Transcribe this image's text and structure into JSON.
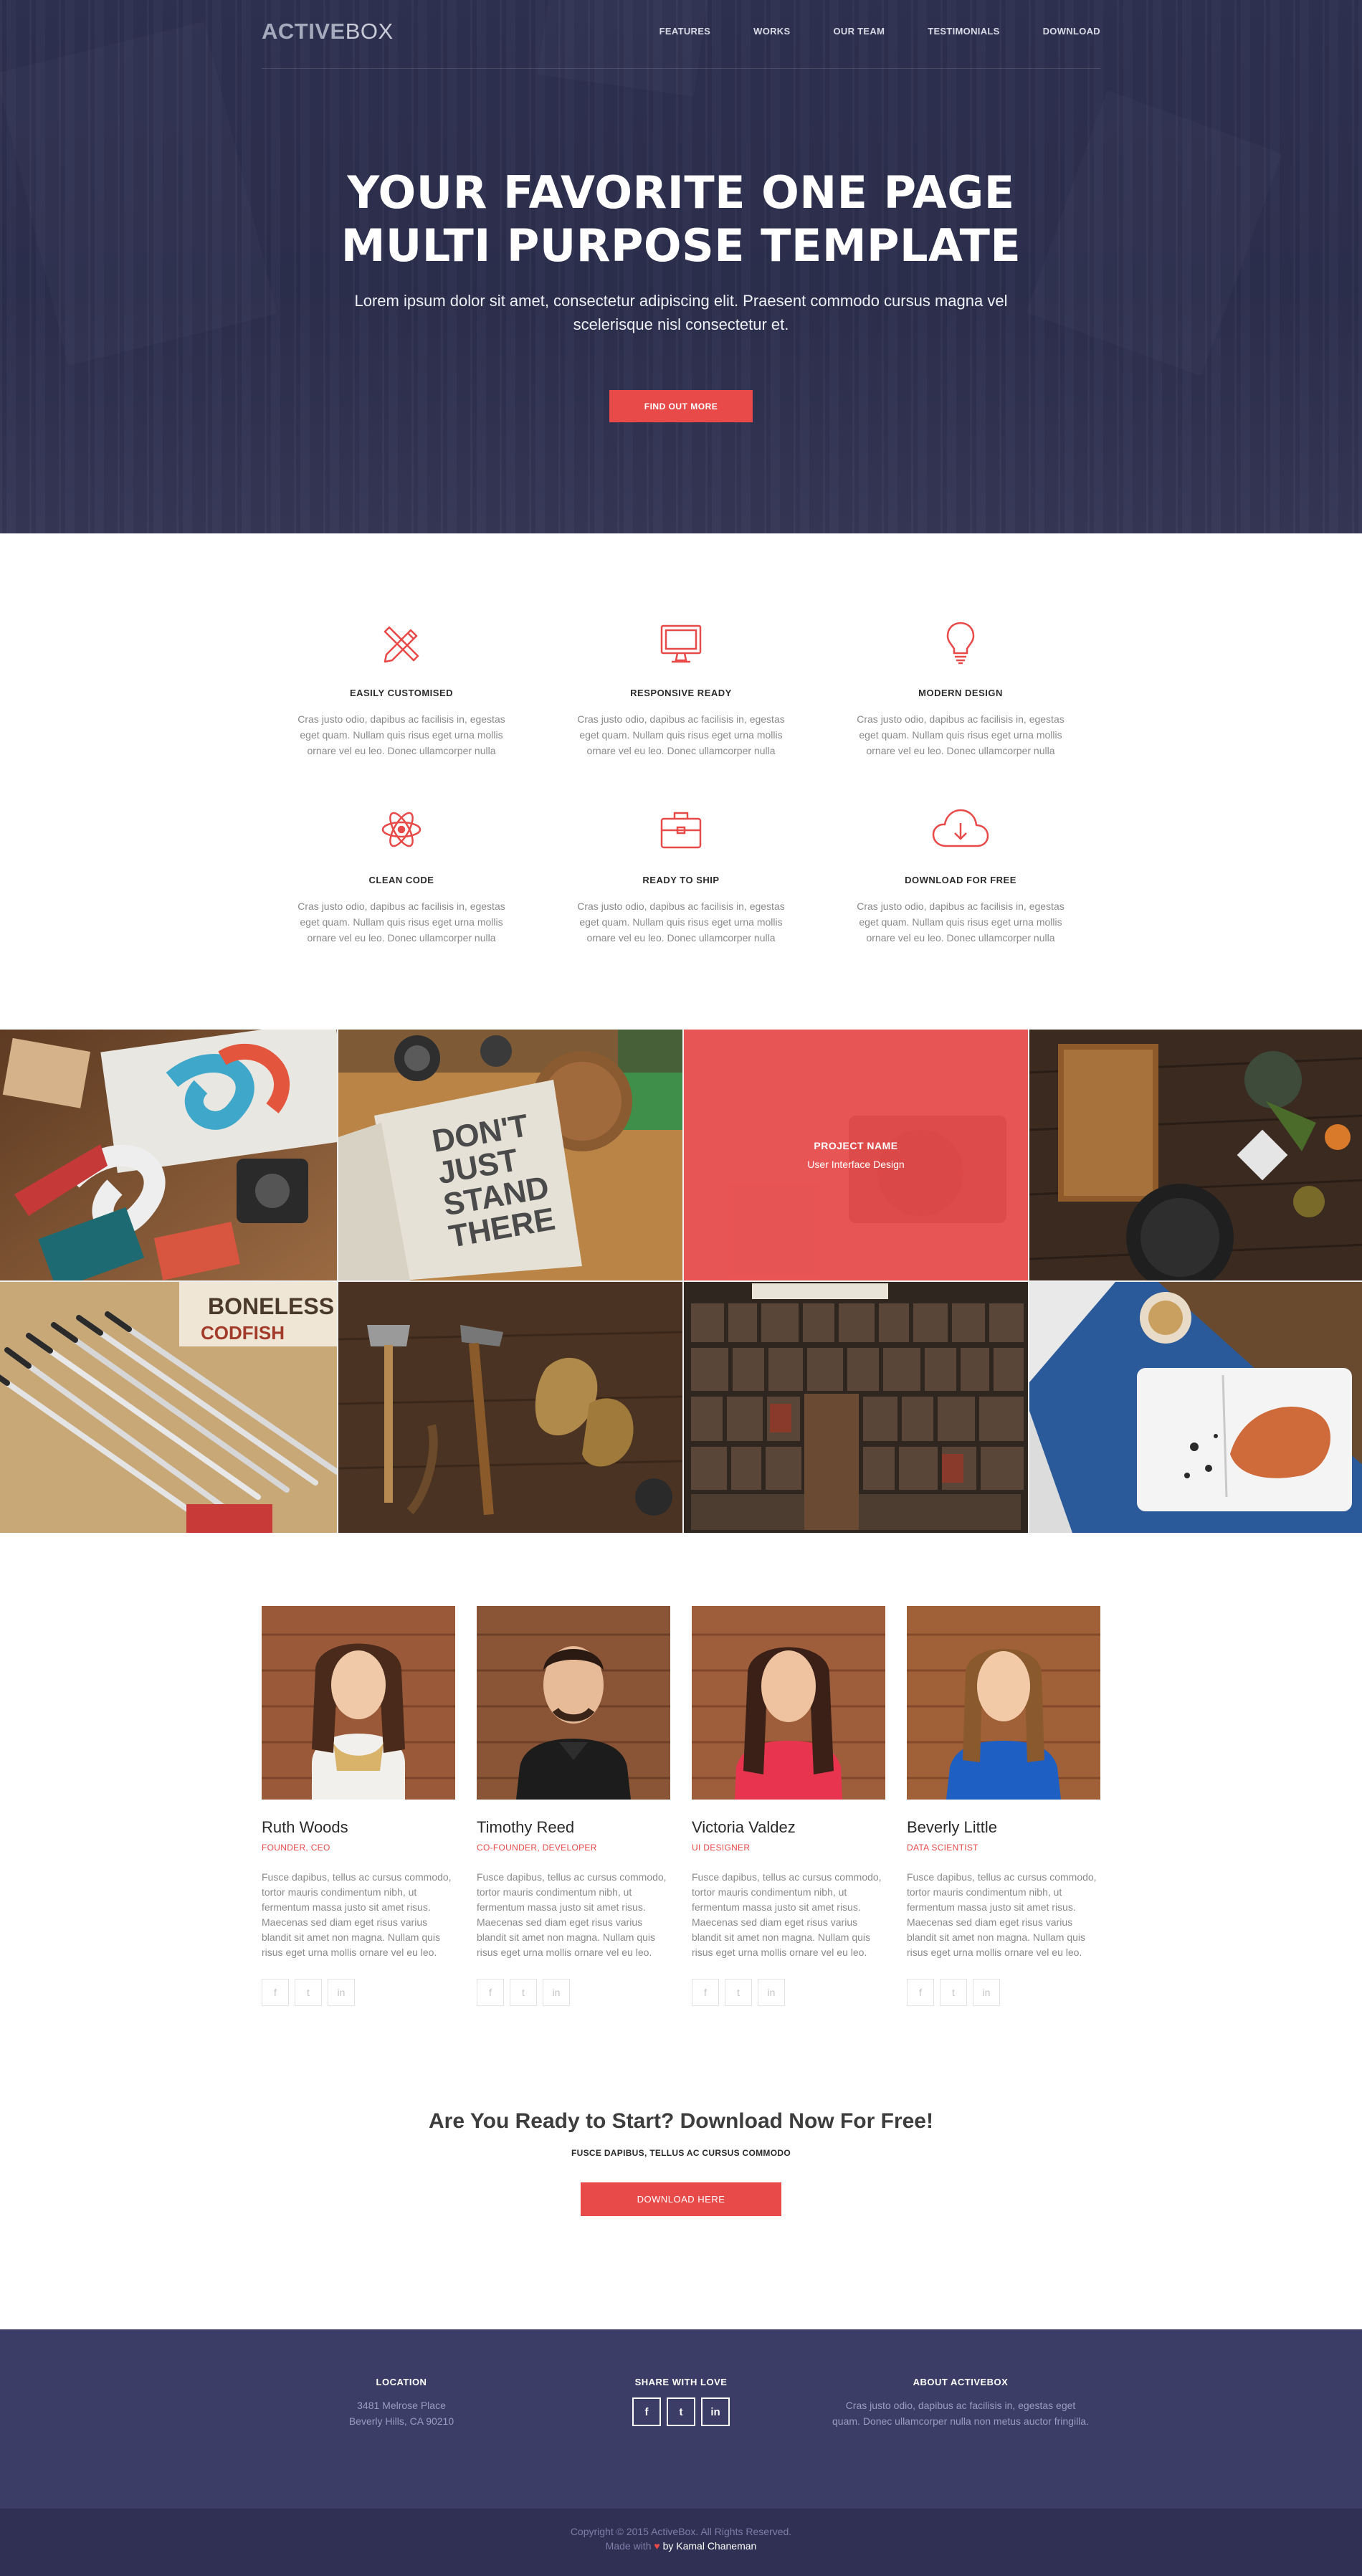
{
  "nav": {
    "logo_bold": "ACTIVE",
    "logo_light": "BOX",
    "items": [
      "FEATURES",
      "WORKS",
      "OUR TEAM",
      "TESTIMONIALS",
      "DOWNLOAD"
    ]
  },
  "hero": {
    "title_line1": "YOUR FAVORITE ONE PAGE",
    "title_line2": "MULTI PURPOSE TEMPLATE",
    "subtitle": "Lorem ipsum dolor sit amet, consectetur adipiscing elit. Praesent commodo cursus magna vel scelerisque nisl consectetur et.",
    "button": "FIND OUT MORE"
  },
  "features": [
    {
      "icon": "pencil-ruler-icon",
      "title": "EASILY CUSTOMISED",
      "text": "Cras justo odio, dapibus ac facilisis in, egestas eget quam. Nullam quis risus eget urna mollis ornare vel eu leo. Donec ullamcorper nulla"
    },
    {
      "icon": "monitor-icon",
      "title": "RESPONSIVE READY",
      "text": "Cras justo odio, dapibus ac facilisis in, egestas eget quam. Nullam quis risus eget urna mollis ornare vel eu leo. Donec ullamcorper nulla"
    },
    {
      "icon": "lightbulb-icon",
      "title": "MODERN DESIGN",
      "text": "Cras justo odio, dapibus ac facilisis in, egestas eget quam. Nullam quis risus eget urna mollis ornare vel eu leo. Donec ullamcorper nulla"
    },
    {
      "icon": "atom-icon",
      "title": "CLEAN CODE",
      "text": "Cras justo odio, dapibus ac facilisis in, egestas eget quam. Nullam quis risus eget urna mollis ornare vel eu leo. Donec ullamcorper nulla"
    },
    {
      "icon": "briefcase-icon",
      "title": "READY TO SHIP",
      "text": "Cras justo odio, dapibus ac facilisis in, egestas eget quam. Nullam quis risus eget urna mollis ornare vel eu leo. Donec ullamcorper nulla"
    },
    {
      "icon": "cloud-download-icon",
      "title": "DOWNLOAD FOR FREE",
      "text": "Cras justo odio, dapibus ac facilisis in, egestas eget quam. Nullam quis risus eget urna mollis ornare vel eu leo. Donec ullamcorper nulla"
    }
  ],
  "portfolio": {
    "overlay_title": "PROJECT NAME",
    "overlay_subtitle": "User Interface Design",
    "tiles": [
      "branding-stationery-photo",
      "dont-just-stand-there-notebook-photo",
      "vintage-camera-photo",
      "kitchen-utensils-photo",
      "pencils-and-sign-photo",
      "hand-tools-photo",
      "letterpress-type-photo",
      "food-plate-photo"
    ]
  },
  "team": [
    {
      "name": "Ruth Woods",
      "role": "FOUNDER, CEO",
      "bio": "Fusce dapibus, tellus ac cursus commodo, tortor mauris condimentum nibh, ut fermentum massa justo sit amet risus. Maecenas sed diam eget risus varius blandit sit amet non magna. Nullam quis risus eget urna mollis ornare vel eu leo."
    },
    {
      "name": "Timothy Reed",
      "role": "CO-FOUNDER, DEVELOPER",
      "bio": "Fusce dapibus, tellus ac cursus commodo, tortor mauris condimentum nibh, ut fermentum massa justo sit amet risus. Maecenas sed diam eget risus varius blandit sit amet non magna. Nullam quis risus eget urna mollis ornare vel eu leo."
    },
    {
      "name": "Victoria Valdez",
      "role": "UI DESIGNER",
      "bio": "Fusce dapibus, tellus ac cursus commodo, tortor mauris condimentum nibh, ut fermentum massa justo sit amet risus. Maecenas sed diam eget risus varius blandit sit amet non magna. Nullam quis risus eget urna mollis ornare vel eu leo."
    },
    {
      "name": "Beverly Little",
      "role": "DATA SCIENTIST",
      "bio": "Fusce dapibus, tellus ac cursus commodo, tortor mauris condimentum nibh, ut fermentum massa justo sit amet risus. Maecenas sed diam eget risus varius blandit sit amet non magna. Nullam quis risus eget urna mollis ornare vel eu leo."
    }
  ],
  "team_social": {
    "facebook": "f",
    "twitter": "t",
    "linkedin": "in"
  },
  "cta": {
    "title": "Are You Ready to Start? Download Now For Free!",
    "subtitle": "FUSCE DAPIBUS, TELLUS AC CURSUS COMMODO",
    "button": "DOWNLOAD HERE"
  },
  "footer": {
    "location_title": "LOCATION",
    "address_line1": "3481 Melrose Place",
    "address_line2": "Beverly Hills, CA 90210",
    "share_title": "SHARE WITH LOVE",
    "share_icons": {
      "facebook": "f",
      "twitter": "t",
      "linkedin": "in"
    },
    "about_title": "ABOUT ACTIVEBOX",
    "about_text": "Cras justo odio, dapibus ac facilisis in, egestas eget quam. Donec ullamcorper nulla non metus auctor fringilla.",
    "copyright": "Copyright © 2015 ActiveBox. All Rights Reserved.",
    "made_with": "Made with",
    "heart": "♥",
    "by_author": "by Kamal Chaneman"
  },
  "colors": {
    "accent": "#e84a4a",
    "hero_bg": "#2f3150",
    "footer_bg": "#3b3d66",
    "bottom_bar": "#2f3053"
  }
}
